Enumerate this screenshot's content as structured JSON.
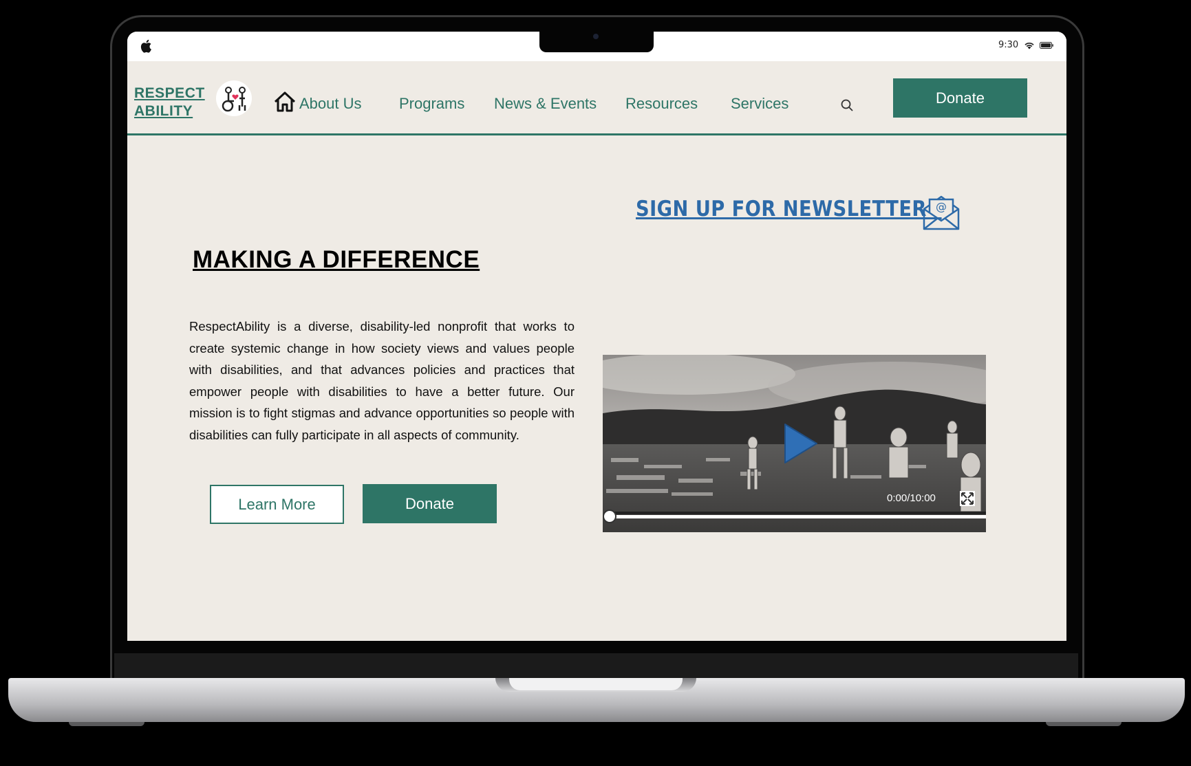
{
  "status_bar": {
    "time": "9:30"
  },
  "logo": {
    "line1": "RESPECT",
    "line2": "ABILITY"
  },
  "nav": {
    "links": [
      "About Us",
      "Programs",
      "News & Events",
      "Resources",
      "Services"
    ],
    "donate_label": "Donate"
  },
  "newsletter": {
    "label": "SIGN UP FOR NEWSLETTER -"
  },
  "main": {
    "headline": "MAKING A DIFFERENCE",
    "body": "RespectAbility is a diverse, disability-led nonprofit that works to create systemic change in how society views and values people with disabilities, and that advances policies and practices that empower people with disabilities to have a better future. Our mission is to fight stigmas and advance opportunities so people with disabilities can fully participate in all aspects of community.",
    "learn_more_label": "Learn More",
    "donate_label": "Donate"
  },
  "video": {
    "time": "0:00/10:00",
    "progress": 0
  },
  "colors": {
    "brand": "#2e7566",
    "newsletter": "#2d6aa8",
    "page_bg": "#efebe5"
  }
}
